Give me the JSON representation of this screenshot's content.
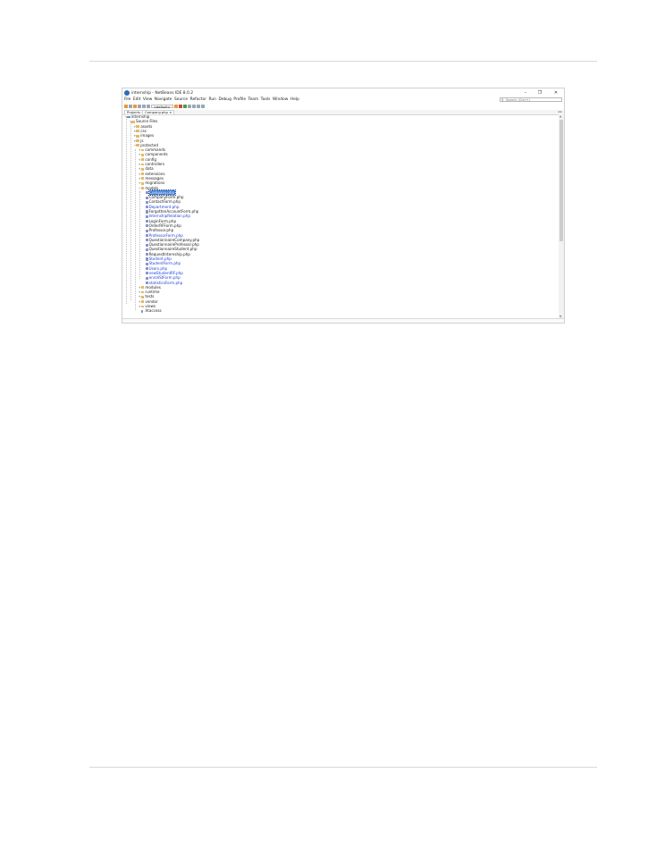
{
  "window": {
    "title": "internship - NetBeans IDE 8.0.2",
    "controls": {
      "minimize": "–",
      "maximize": "❐",
      "close": "✕"
    }
  },
  "menu": [
    "File",
    "Edit",
    "View",
    "Navigate",
    "Source",
    "Refactor",
    "Run",
    "Debug",
    "Profile",
    "Team",
    "Tools",
    "Window",
    "Help"
  ],
  "search": {
    "placeholder": "Search (Ctrl+I)",
    "icon": "search-icon"
  },
  "toolbar": {
    "config_combo": "<default>"
  },
  "tabs": [
    {
      "label": "Projects ×",
      "icon": "projects-icon"
    },
    {
      "label": "Company.php ×",
      "icon": "php-file-icon"
    }
  ],
  "tree": [
    {
      "label": "internship",
      "depth": 0,
      "type": "project",
      "open": true
    },
    {
      "label": "Source Files",
      "depth": 1,
      "type": "folder",
      "open": true
    },
    {
      "label": "assets",
      "depth": 2,
      "type": "folder"
    },
    {
      "label": "css",
      "depth": 2,
      "type": "folder"
    },
    {
      "label": "images",
      "depth": 2,
      "type": "folder"
    },
    {
      "label": "js",
      "depth": 2,
      "type": "folder"
    },
    {
      "label": "protected",
      "depth": 2,
      "type": "folder",
      "open": true
    },
    {
      "label": "commands",
      "depth": 3,
      "type": "folder"
    },
    {
      "label": "components",
      "depth": 3,
      "type": "folder"
    },
    {
      "label": "config",
      "depth": 3,
      "type": "folder"
    },
    {
      "label": "controllers",
      "depth": 3,
      "type": "folder"
    },
    {
      "label": "data",
      "depth": 3,
      "type": "folder"
    },
    {
      "label": "extensions",
      "depth": 3,
      "type": "folder"
    },
    {
      "label": "messages",
      "depth": 3,
      "type": "folder"
    },
    {
      "label": "migrations",
      "depth": 3,
      "type": "folder"
    },
    {
      "label": "models",
      "depth": 3,
      "type": "folder",
      "open": true
    },
    {
      "label": "Company.php",
      "depth": 4,
      "type": "php",
      "selected": true
    },
    {
      "label": "CompanyForm.php",
      "depth": 4,
      "type": "php"
    },
    {
      "label": "ContactForm.php",
      "depth": 4,
      "type": "php"
    },
    {
      "label": "Department.php",
      "depth": 4,
      "type": "php",
      "link": true
    },
    {
      "label": "ForgottenAccountForm.php",
      "depth": 4,
      "type": "php"
    },
    {
      "label": "InternshipRelation.php",
      "depth": 4,
      "type": "php",
      "link": true
    },
    {
      "label": "LoginForm.php",
      "depth": 4,
      "type": "php"
    },
    {
      "label": "OrderRFForm.php",
      "depth": 4,
      "type": "php"
    },
    {
      "label": "Professor.php",
      "depth": 4,
      "type": "php"
    },
    {
      "label": "ProfessorForm.php",
      "depth": 4,
      "type": "php",
      "link": true
    },
    {
      "label": "QuestionnaireCompany.php",
      "depth": 4,
      "type": "php"
    },
    {
      "label": "QuestionnaireProfessor.php",
      "depth": 4,
      "type": "php"
    },
    {
      "label": "QuestionnaireStudent.php",
      "depth": 4,
      "type": "php"
    },
    {
      "label": "RequestInternship.php",
      "depth": 4,
      "type": "php"
    },
    {
      "label": "Student.php",
      "depth": 4,
      "type": "php",
      "link": true
    },
    {
      "label": "StudentForm.php",
      "depth": 4,
      "type": "php",
      "link": true
    },
    {
      "label": "Users.php",
      "depth": 4,
      "type": "php",
      "link": true
    },
    {
      "label": "newStudentRF.php",
      "depth": 4,
      "type": "php",
      "link": true
    },
    {
      "label": "enrollStForm.php",
      "depth": 4,
      "type": "php",
      "link": true
    },
    {
      "label": "statisticsForm.php",
      "depth": 4,
      "type": "php",
      "link": true
    },
    {
      "label": "modules",
      "depth": 3,
      "type": "folder"
    },
    {
      "label": "runtime",
      "depth": 3,
      "type": "folder"
    },
    {
      "label": "tests",
      "depth": 3,
      "type": "folder"
    },
    {
      "label": "vendor",
      "depth": 3,
      "type": "folder"
    },
    {
      "label": "views",
      "depth": 3,
      "type": "folder"
    },
    {
      "label": ".htaccess",
      "depth": 3,
      "type": "file"
    }
  ],
  "colors": {
    "link": "#1f3fd6",
    "selection": "#3a78d4",
    "folder": "#e2b866"
  }
}
